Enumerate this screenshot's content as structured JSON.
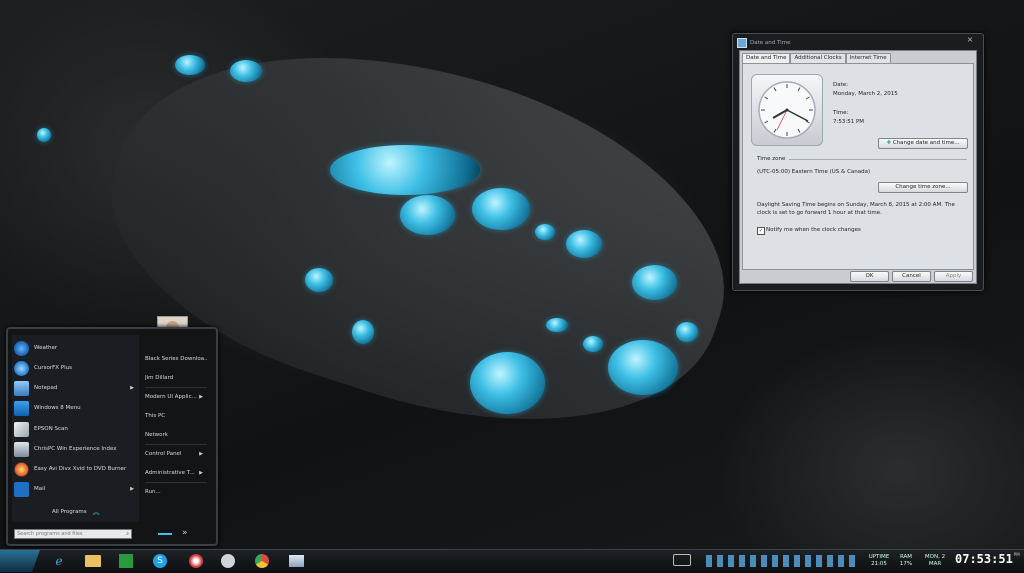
{
  "dialog": {
    "title": "Date and Time",
    "close_label": "×",
    "tabs": [
      "Date and Time",
      "Additional Clocks",
      "Internet Time"
    ],
    "date_label": "Date:",
    "date_value": "Monday, March 2, 2015",
    "time_label": "Time:",
    "time_value": "7:53:51 PM",
    "change_datetime_button": "Change date and time...",
    "timezone_heading": "Time zone",
    "timezone_value": "(UTC-05:00) Eastern Time (US & Canada)",
    "change_timezone_button": "Change time zone...",
    "dst_text_line1": "Daylight Saving Time begins on Sunday, March 8, 2015 at 2:00 AM. The",
    "dst_text_line2": "clock is set to go forward 1 hour at that time.",
    "notify_label": "Notify me when the clock changes",
    "notify_checked": true,
    "ok_button": "OK",
    "cancel_button": "Cancel",
    "apply_button": "Apply"
  },
  "start_menu": {
    "left_items": [
      {
        "label": "Weather",
        "icon": "weather-icon",
        "has_arrow": false
      },
      {
        "label": "CursorFX Plus",
        "icon": "cursor-icon",
        "has_arrow": false
      },
      {
        "label": "Notepad",
        "icon": "notepad-icon",
        "has_arrow": true
      },
      {
        "label": "Windows 8 Menu",
        "icon": "windows-menu-icon",
        "has_arrow": false
      },
      {
        "label": "EPSON Scan",
        "icon": "scanner-icon",
        "has_arrow": false
      },
      {
        "label": "ChrisPC Win Experience Index",
        "icon": "monitor-icon",
        "has_arrow": false
      },
      {
        "label": "Easy Avi Divx Xvid to DVD Burner",
        "icon": "dvd-burner-icon",
        "has_arrow": false
      },
      {
        "label": "Mail",
        "icon": "mail-icon",
        "has_arrow": true
      }
    ],
    "all_programs_label": "All Programs",
    "right_items": [
      {
        "label": "Black Series Downloa...",
        "has_arrow": false
      },
      {
        "label": "Jim Dillard",
        "has_arrow": false
      },
      {
        "label": "Modern UI Applic...",
        "has_arrow": true
      },
      {
        "label": "This PC",
        "has_arrow": false
      },
      {
        "label": "Network",
        "has_arrow": false
      },
      {
        "label": "Control Panel",
        "has_arrow": true
      },
      {
        "label": "Administrative T...",
        "has_arrow": true
      },
      {
        "label": "Run...",
        "has_arrow": false
      }
    ],
    "search_placeholder": "Search programs and files",
    "power_arrow": "»"
  },
  "taskbar": {
    "pinned": [
      "internet-explorer-icon",
      "file-explorer-icon",
      "store-icon",
      "skype-icon",
      "paint-icon",
      "steam-icon",
      "chrome-icon",
      "control-panel-icon"
    ],
    "uptime_label": "UPTIME",
    "uptime_value": "21:05",
    "ram_label": "RAM",
    "ram_value": "17%",
    "date_line1": "MON, 2",
    "date_line2": "MAR",
    "clock": "07:53:51",
    "clock_suffix": "PM"
  },
  "colors": {
    "accent": "#3fc0e6",
    "dialog_bg": "#c9cdd2",
    "taskbar_bg": "#15181b"
  }
}
